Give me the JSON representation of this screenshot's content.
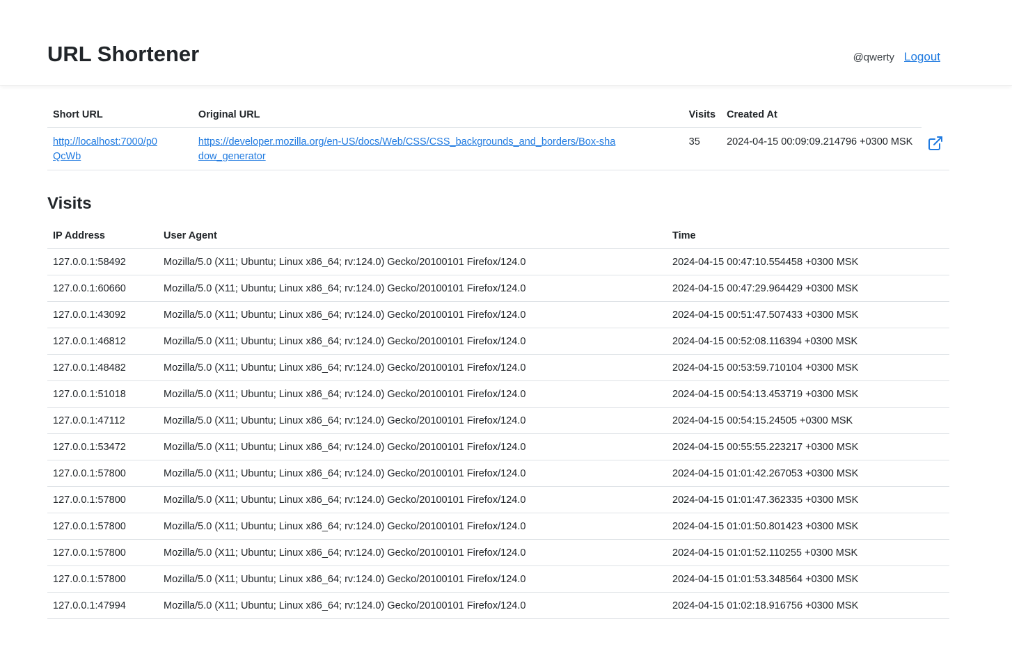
{
  "header": {
    "title": "URL Shortener",
    "username": "@qwerty",
    "logout_label": "Logout"
  },
  "colors": {
    "link": "#1f7ae0",
    "text": "#212529",
    "border": "#dee2e6"
  },
  "url_table": {
    "columns": {
      "short_url": "Short URL",
      "original_url": "Original URL",
      "visits": "Visits",
      "created_at": "Created At"
    },
    "row": {
      "short_url": "http://localhost:7000/p0QcWb",
      "original_url": "https://developer.mozilla.org/en-US/docs/Web/CSS/CSS_backgrounds_and_borders/Box-shadow_generator",
      "visits": "35",
      "created_at": "2024-04-15 00:09:09.214796 +0300 MSK",
      "action_icon": "external-link-icon"
    }
  },
  "visits_section": {
    "title": "Visits",
    "columns": {
      "ip": "IP Address",
      "user_agent": "User Agent",
      "time": "Time"
    },
    "rows": [
      {
        "ip": "127.0.0.1:58492",
        "user_agent": "Mozilla/5.0 (X11; Ubuntu; Linux x86_64; rv:124.0) Gecko/20100101 Firefox/124.0",
        "time": "2024-04-15 00:47:10.554458 +0300 MSK"
      },
      {
        "ip": "127.0.0.1:60660",
        "user_agent": "Mozilla/5.0 (X11; Ubuntu; Linux x86_64; rv:124.0) Gecko/20100101 Firefox/124.0",
        "time": "2024-04-15 00:47:29.964429 +0300 MSK"
      },
      {
        "ip": "127.0.0.1:43092",
        "user_agent": "Mozilla/5.0 (X11; Ubuntu; Linux x86_64; rv:124.0) Gecko/20100101 Firefox/124.0",
        "time": "2024-04-15 00:51:47.507433 +0300 MSK"
      },
      {
        "ip": "127.0.0.1:46812",
        "user_agent": "Mozilla/5.0 (X11; Ubuntu; Linux x86_64; rv:124.0) Gecko/20100101 Firefox/124.0",
        "time": "2024-04-15 00:52:08.116394 +0300 MSK"
      },
      {
        "ip": "127.0.0.1:48482",
        "user_agent": "Mozilla/5.0 (X11; Ubuntu; Linux x86_64; rv:124.0) Gecko/20100101 Firefox/124.0",
        "time": "2024-04-15 00:53:59.710104 +0300 MSK"
      },
      {
        "ip": "127.0.0.1:51018",
        "user_agent": "Mozilla/5.0 (X11; Ubuntu; Linux x86_64; rv:124.0) Gecko/20100101 Firefox/124.0",
        "time": "2024-04-15 00:54:13.453719 +0300 MSK"
      },
      {
        "ip": "127.0.0.1:47112",
        "user_agent": "Mozilla/5.0 (X11; Ubuntu; Linux x86_64; rv:124.0) Gecko/20100101 Firefox/124.0",
        "time": "2024-04-15 00:54:15.24505 +0300 MSK"
      },
      {
        "ip": "127.0.0.1:53472",
        "user_agent": "Mozilla/5.0 (X11; Ubuntu; Linux x86_64; rv:124.0) Gecko/20100101 Firefox/124.0",
        "time": "2024-04-15 00:55:55.223217 +0300 MSK"
      },
      {
        "ip": "127.0.0.1:57800",
        "user_agent": "Mozilla/5.0 (X11; Ubuntu; Linux x86_64; rv:124.0) Gecko/20100101 Firefox/124.0",
        "time": "2024-04-15 01:01:42.267053 +0300 MSK"
      },
      {
        "ip": "127.0.0.1:57800",
        "user_agent": "Mozilla/5.0 (X11; Ubuntu; Linux x86_64; rv:124.0) Gecko/20100101 Firefox/124.0",
        "time": "2024-04-15 01:01:47.362335 +0300 MSK"
      },
      {
        "ip": "127.0.0.1:57800",
        "user_agent": "Mozilla/5.0 (X11; Ubuntu; Linux x86_64; rv:124.0) Gecko/20100101 Firefox/124.0",
        "time": "2024-04-15 01:01:50.801423 +0300 MSK"
      },
      {
        "ip": "127.0.0.1:57800",
        "user_agent": "Mozilla/5.0 (X11; Ubuntu; Linux x86_64; rv:124.0) Gecko/20100101 Firefox/124.0",
        "time": "2024-04-15 01:01:52.110255 +0300 MSK"
      },
      {
        "ip": "127.0.0.1:57800",
        "user_agent": "Mozilla/5.0 (X11; Ubuntu; Linux x86_64; rv:124.0) Gecko/20100101 Firefox/124.0",
        "time": "2024-04-15 01:01:53.348564 +0300 MSK"
      },
      {
        "ip": "127.0.0.1:47994",
        "user_agent": "Mozilla/5.0 (X11; Ubuntu; Linux x86_64; rv:124.0) Gecko/20100101 Firefox/124.0",
        "time": "2024-04-15 01:02:18.916756 +0300 MSK"
      }
    ]
  }
}
